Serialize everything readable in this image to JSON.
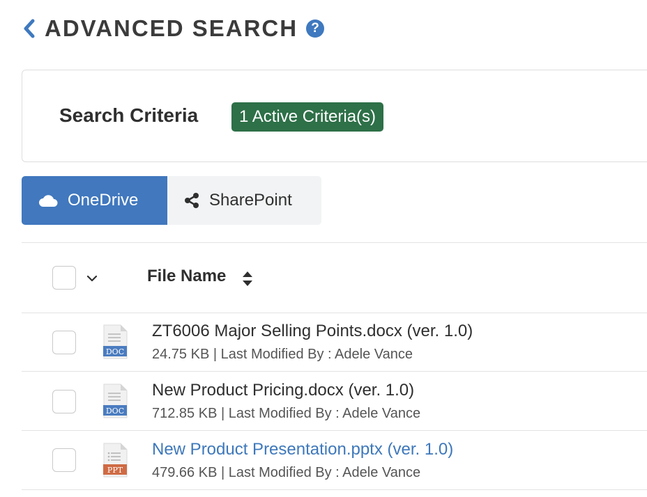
{
  "header": {
    "title": "ADVANCED SEARCH",
    "back_icon": "chevron-left-icon",
    "help_icon": "question-circle-icon",
    "help_glyph": "?",
    "accent_color": "#3f79bf"
  },
  "criteria": {
    "title": "Search Criteria",
    "badge": "1 Active Criteria(s)",
    "badge_color": "#2e7048"
  },
  "tabs": [
    {
      "label": "OneDrive",
      "icon": "cloud-icon",
      "active": true,
      "color": "#4178be"
    },
    {
      "label": "SharePoint",
      "icon": "share-icon",
      "active": false
    }
  ],
  "table": {
    "columns": [
      {
        "label": "File Name",
        "sortable": true,
        "sort_icon": "sort-icon"
      }
    ],
    "rows": [
      {
        "name": "ZT6006 Major Selling Points.docx (ver. 1.0)",
        "size": "24.75 KB",
        "separator": "|",
        "modified_by": "Last Modified By : Adele Vance",
        "icon_label": "DOC",
        "icon": "doc-file-icon",
        "link": false
      },
      {
        "name": "New Product Pricing.docx (ver. 1.0)",
        "size": "712.85 KB",
        "separator": "|",
        "modified_by": "Last Modified By : Adele Vance",
        "icon_label": "DOC",
        "icon": "doc-file-icon",
        "link": false
      },
      {
        "name": "New Product Presentation.pptx (ver. 1.0)",
        "size": "479.66 KB",
        "separator": "|",
        "modified_by": "Last Modified By : Adele Vance",
        "icon_label": "PPT",
        "icon": "ppt-file-icon",
        "link": true
      }
    ]
  }
}
